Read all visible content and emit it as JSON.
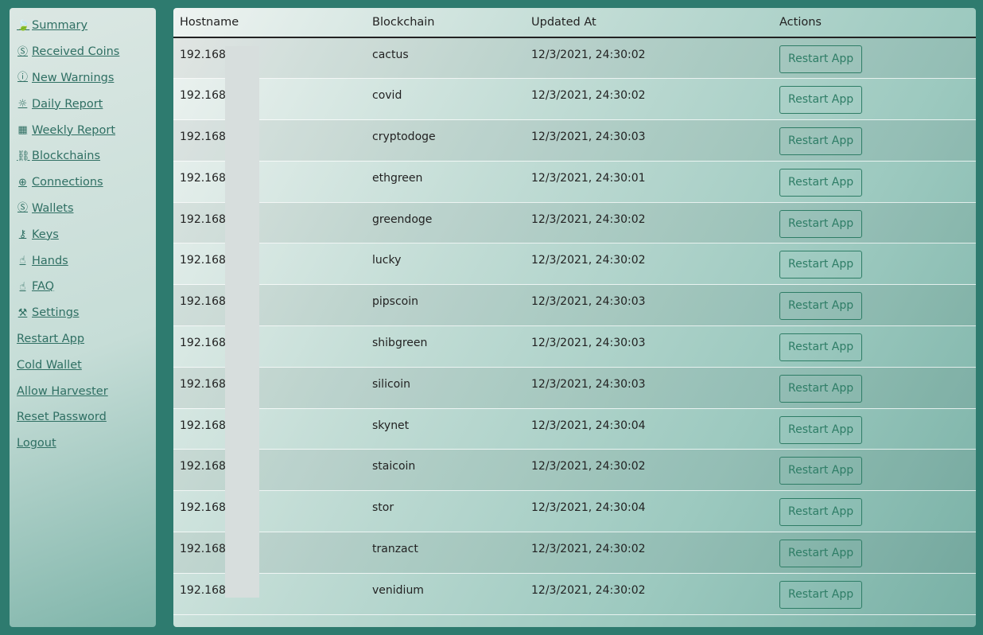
{
  "sidebar": {
    "items": [
      {
        "label": "Summary",
        "icon": "leaf-icon",
        "glyph": "🍃"
      },
      {
        "label": "Received Coins",
        "icon": "coin-icon",
        "glyph": "Ⓢ"
      },
      {
        "label": "New Warnings",
        "icon": "warning-icon",
        "glyph": "ⓘ"
      },
      {
        "label": "Daily Report",
        "icon": "sun-icon",
        "glyph": "☼"
      },
      {
        "label": "Weekly Report",
        "icon": "calendar-icon",
        "glyph": "▦"
      },
      {
        "label": "Blockchains",
        "icon": "link-icon",
        "glyph": "⛓"
      },
      {
        "label": "Connections",
        "icon": "globe-icon",
        "glyph": "⊕"
      },
      {
        "label": "Wallets",
        "icon": "wallet-icon",
        "glyph": "Ⓢ"
      },
      {
        "label": "Keys",
        "icon": "key-icon",
        "glyph": "⚷"
      },
      {
        "label": "Hands",
        "icon": "hand-icon",
        "glyph": "☝"
      },
      {
        "label": "FAQ",
        "icon": "faq-icon",
        "glyph": "☝"
      },
      {
        "label": "Settings",
        "icon": "wrench-icon",
        "glyph": "⚒"
      },
      {
        "label": "Restart App",
        "icon": "",
        "glyph": ""
      },
      {
        "label": "Cold Wallet",
        "icon": "",
        "glyph": ""
      },
      {
        "label": "Allow Harvester",
        "icon": "",
        "glyph": ""
      },
      {
        "label": "Reset Password",
        "icon": "",
        "glyph": ""
      },
      {
        "label": "Logout",
        "icon": "",
        "glyph": ""
      }
    ]
  },
  "table": {
    "headers": {
      "hostname": "Hostname",
      "blockchain": "Blockchain",
      "updated": "Updated At",
      "actions": "Actions"
    },
    "action_label": "Restart App",
    "rows": [
      {
        "hostname": "192.168.1",
        "blockchain": "cactus",
        "updated": "12/3/2021, 24:30:02"
      },
      {
        "hostname": "192.168.1",
        "blockchain": "covid",
        "updated": "12/3/2021, 24:30:02"
      },
      {
        "hostname": "192.168.1",
        "blockchain": "cryptodoge",
        "updated": "12/3/2021, 24:30:03"
      },
      {
        "hostname": "192.168.1",
        "blockchain": "ethgreen",
        "updated": "12/3/2021, 24:30:01"
      },
      {
        "hostname": "192.168.1",
        "blockchain": "greendoge",
        "updated": "12/3/2021, 24:30:02"
      },
      {
        "hostname": "192.168.1",
        "blockchain": "lucky",
        "updated": "12/3/2021, 24:30:02"
      },
      {
        "hostname": "192.168.1",
        "blockchain": "pipscoin",
        "updated": "12/3/2021, 24:30:03"
      },
      {
        "hostname": "192.168.1",
        "blockchain": "shibgreen",
        "updated": "12/3/2021, 24:30:03"
      },
      {
        "hostname": "192.168.1",
        "blockchain": "silicoin",
        "updated": "12/3/2021, 24:30:03"
      },
      {
        "hostname": "192.168.1",
        "blockchain": "skynet",
        "updated": "12/3/2021, 24:30:04"
      },
      {
        "hostname": "192.168.1",
        "blockchain": "staicoin",
        "updated": "12/3/2021, 24:30:02"
      },
      {
        "hostname": "192.168.1",
        "blockchain": "stor",
        "updated": "12/3/2021, 24:30:04"
      },
      {
        "hostname": "192.168.1",
        "blockchain": "tranzact",
        "updated": "12/3/2021, 24:30:02"
      },
      {
        "hostname": "192.168.1",
        "blockchain": "venidium",
        "updated": "12/3/2021, 24:30:02"
      }
    ]
  },
  "colors": {
    "page_bg": "#2e7b6f",
    "link": "#2f6f63",
    "button": "#2e7d66"
  }
}
